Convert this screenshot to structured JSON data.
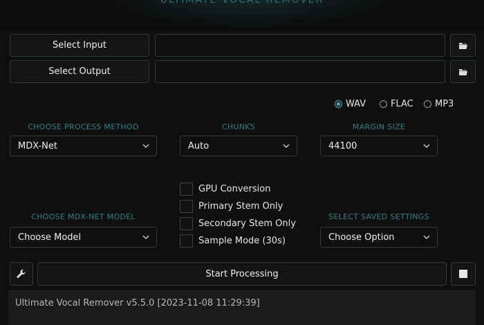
{
  "header": {
    "title": "ULTIMATE VOCAL REMOVER"
  },
  "io": {
    "select_input_label": "Select Input",
    "select_output_label": "Select Output",
    "input_path": "",
    "output_path": ""
  },
  "format": {
    "options": [
      "WAV",
      "FLAC",
      "MP3"
    ],
    "selected": "WAV"
  },
  "settings": {
    "process_method_label": "CHOOSE PROCESS METHOD",
    "process_method_value": "MDX-Net",
    "chunks_label": "CHUNKS",
    "chunks_value": "Auto",
    "margin_label": "MARGIN SIZE",
    "margin_value": "44100",
    "model_label": "CHOOSE MDX-NET MODEL",
    "model_value": "Choose Model",
    "saved_label": "SELECT SAVED SETTINGS",
    "saved_value": "Choose Option"
  },
  "options": [
    {
      "label": "GPU Conversion",
      "checked": false
    },
    {
      "label": "Primary Stem Only",
      "checked": false
    },
    {
      "label": "Secondary Stem Only",
      "checked": false
    },
    {
      "label": "Sample Mode (30s)",
      "checked": false
    }
  ],
  "actions": {
    "start_label": "Start Processing"
  },
  "console": {
    "text": "Ultimate Vocal Remover v5.5.0 [2023-11-08 11:29:39]"
  },
  "icons": [
    "folder-icon",
    "wrench-icon",
    "stop-icon",
    "chevron-down-icon"
  ],
  "colors": {
    "accent": "#4fb3b8",
    "label": "#2f7f86",
    "border": "#2e3b3b",
    "background": "#0f0f0f"
  }
}
